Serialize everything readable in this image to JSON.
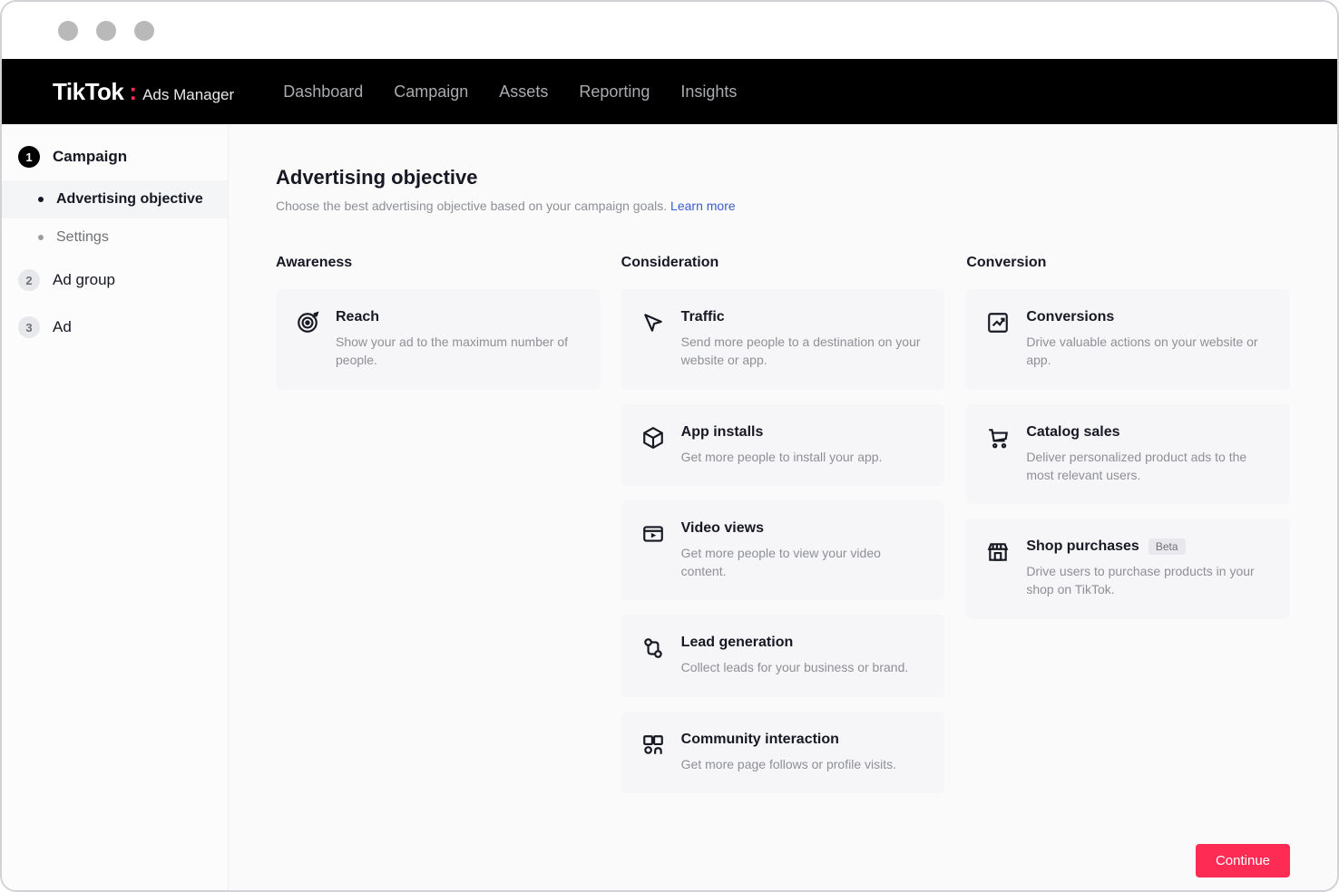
{
  "brand": {
    "mark": "TikTok",
    "sub": "Ads Manager"
  },
  "nav": {
    "items": [
      {
        "label": "Dashboard"
      },
      {
        "label": "Campaign"
      },
      {
        "label": "Assets"
      },
      {
        "label": "Reporting"
      },
      {
        "label": "Insights"
      }
    ]
  },
  "sidebar": {
    "steps": [
      {
        "num": "1",
        "label": "Campaign",
        "active": true,
        "subs": [
          {
            "label": "Advertising objective",
            "current": true
          },
          {
            "label": "Settings",
            "current": false
          }
        ]
      },
      {
        "num": "2",
        "label": "Ad group",
        "active": false,
        "subs": []
      },
      {
        "num": "3",
        "label": "Ad",
        "active": false,
        "subs": []
      }
    ]
  },
  "page": {
    "title": "Advertising objective",
    "subtitle": "Choose the best advertising objective based on your campaign goals.",
    "learn_more": "Learn more"
  },
  "columns": {
    "awareness": {
      "title": "Awareness",
      "cards": [
        {
          "key": "reach",
          "title": "Reach",
          "desc": "Show your ad to the maximum number of people."
        }
      ]
    },
    "consideration": {
      "title": "Consideration",
      "cards": [
        {
          "key": "traffic",
          "title": "Traffic",
          "desc": "Send more people to a destination on your website or app."
        },
        {
          "key": "app-installs",
          "title": "App installs",
          "desc": "Get more people to install your app."
        },
        {
          "key": "video-views",
          "title": "Video views",
          "desc": "Get more people to view your video content."
        },
        {
          "key": "lead-generation",
          "title": "Lead generation",
          "desc": "Collect leads for your business or brand."
        },
        {
          "key": "community-interaction",
          "title": "Community interaction",
          "desc": "Get more page follows or profile visits."
        }
      ]
    },
    "conversion": {
      "title": "Conversion",
      "cards": [
        {
          "key": "conversions",
          "title": "Conversions",
          "desc": "Drive valuable actions on your website or app."
        },
        {
          "key": "catalog-sales",
          "title": "Catalog sales",
          "desc": "Deliver personalized product ads to the most relevant users."
        },
        {
          "key": "shop-purchases",
          "title": "Shop purchases",
          "badge": "Beta",
          "desc": "Drive users to purchase products in your shop on TikTok."
        }
      ]
    }
  },
  "continue_label": "Continue"
}
